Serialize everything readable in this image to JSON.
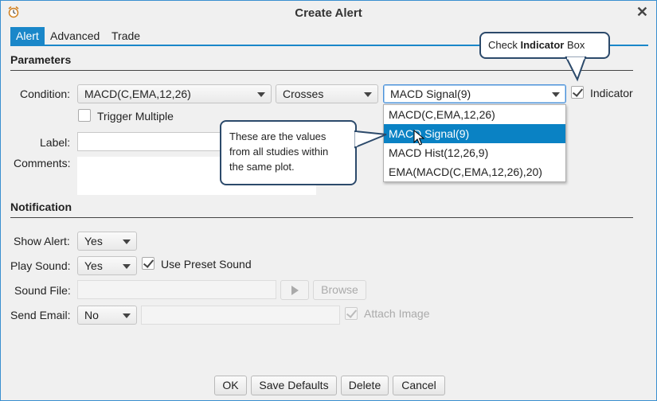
{
  "window": {
    "title": "Create Alert"
  },
  "tabs": [
    {
      "label": "Alert",
      "active": true
    },
    {
      "label": "Advanced",
      "active": false
    },
    {
      "label": "Trade",
      "active": false
    }
  ],
  "parameters": {
    "section_title": "Parameters",
    "condition_label": "Condition:",
    "condition_value": "MACD(C,EMA,12,26)",
    "operator_value": "Crosses",
    "target_value": "MACD Signal(9)",
    "indicator_label": "Indicator",
    "indicator_checked": true,
    "trigger_multiple_label": "Trigger Multiple",
    "trigger_multiple_checked": false,
    "label_label": "Label:",
    "label_value": "",
    "comments_label": "Comments:",
    "comments_value": ""
  },
  "dropdown": {
    "options": [
      "MACD(C,EMA,12,26)",
      "MACD Signal(9)",
      "MACD Hist(12,26,9)",
      "EMA(MACD(C,EMA,12,26),20)"
    ],
    "selected_index": 1
  },
  "notification": {
    "section_title": "Notification",
    "show_alert_label": "Show Alert:",
    "show_alert_value": "Yes",
    "play_sound_label": "Play Sound:",
    "play_sound_value": "Yes",
    "use_preset_sound_label": "Use Preset Sound",
    "use_preset_sound_checked": true,
    "sound_file_label": "Sound File:",
    "sound_file_value": "",
    "browse_label": "Browse",
    "send_email_label": "Send Email:",
    "send_email_value": "No",
    "email_value": "",
    "attach_image_label": "Attach Image",
    "attach_image_checked": true
  },
  "buttons": {
    "ok": "OK",
    "save_defaults": "Save Defaults",
    "delete": "Delete",
    "cancel": "Cancel"
  },
  "callouts": {
    "indicator_prefix": "Check ",
    "indicator_bold": "Indicator",
    "indicator_suffix": " Box",
    "studies_line1": "These are the values",
    "studies_line2": "from all studies within",
    "studies_line3": "the same plot."
  },
  "colors": {
    "accent": "#1a87c9",
    "selection": "#0a82c4",
    "callout_border": "#2c4a6b"
  },
  "icons": {
    "app": "alarm-clock-icon",
    "close": "close-icon",
    "dropdown": "chevron-down-icon",
    "play": "play-icon",
    "cursor": "mouse-pointer-icon"
  }
}
